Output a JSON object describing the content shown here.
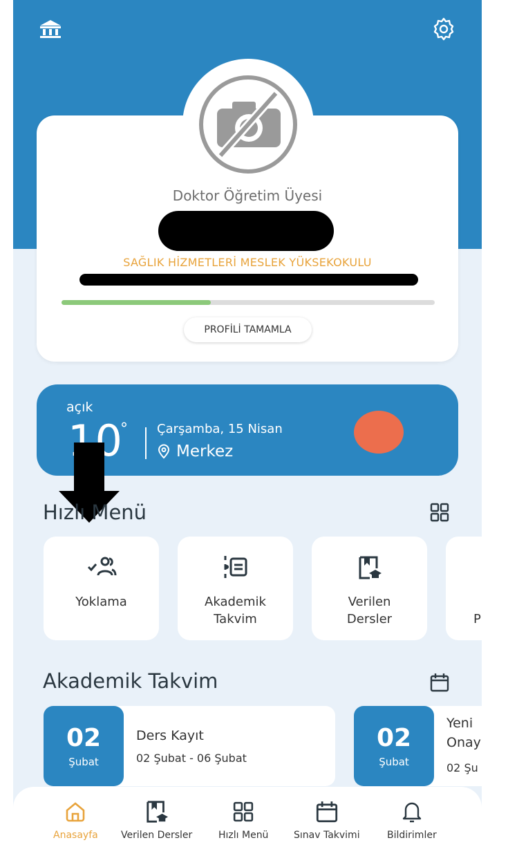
{
  "header": {
    "left_icon": "university-icon",
    "right_icon": "gear-icon"
  },
  "profile": {
    "avatar_icon": "no-camera-icon",
    "title": "Doktor Öğretim Üyesi",
    "school": "SAĞLIK HİZMETLERİ MESLEK YÜKSEKOKULU",
    "progress_fraction": 0.4,
    "complete_button": "PROFİLİ TAMAMLA"
  },
  "weather": {
    "condition": "açık",
    "temperature": "10",
    "degree_symbol": "°",
    "date": "Çarşamba, 15 Nisan",
    "location": "Merkez",
    "sun_color": "#ec6e4d"
  },
  "quick_menu": {
    "title": "Hızlı Menü",
    "items": [
      {
        "label": "Yoklama",
        "icon": "attendance-icon"
      },
      {
        "label": "Akademik\nTakvim",
        "icon": "list-icon"
      },
      {
        "label": "Verilen\nDersler",
        "icon": "book-graduation-icon"
      },
      {
        "label": "P",
        "icon": ""
      }
    ]
  },
  "academic_calendar": {
    "title": "Akademik Takvim",
    "items": [
      {
        "day": "02",
        "month": "Şubat",
        "title": "Ders Kayıt",
        "range": "02 Şubat - 06 Şubat"
      },
      {
        "day": "02",
        "month": "Şubat",
        "title": "Yeni",
        "title2": "Onay",
        "range": "02 Şu"
      }
    ]
  },
  "nav": {
    "items": [
      {
        "label": "Anasayfa",
        "icon": "home-icon",
        "active": true
      },
      {
        "label": "Verilen Dersler",
        "icon": "book-graduation-icon",
        "active": false
      },
      {
        "label": "Hızlı Menü",
        "icon": "grid-icon",
        "active": false
      },
      {
        "label": "Sınav Takvimi",
        "icon": "calendar-icon",
        "active": false
      },
      {
        "label": "Bildirimler",
        "icon": "bell-icon",
        "active": false
      }
    ]
  },
  "colors": {
    "primary": "#2b86c1",
    "accent": "#e8a33b",
    "progress": "#8cc97a",
    "background": "#e9f1f9"
  }
}
